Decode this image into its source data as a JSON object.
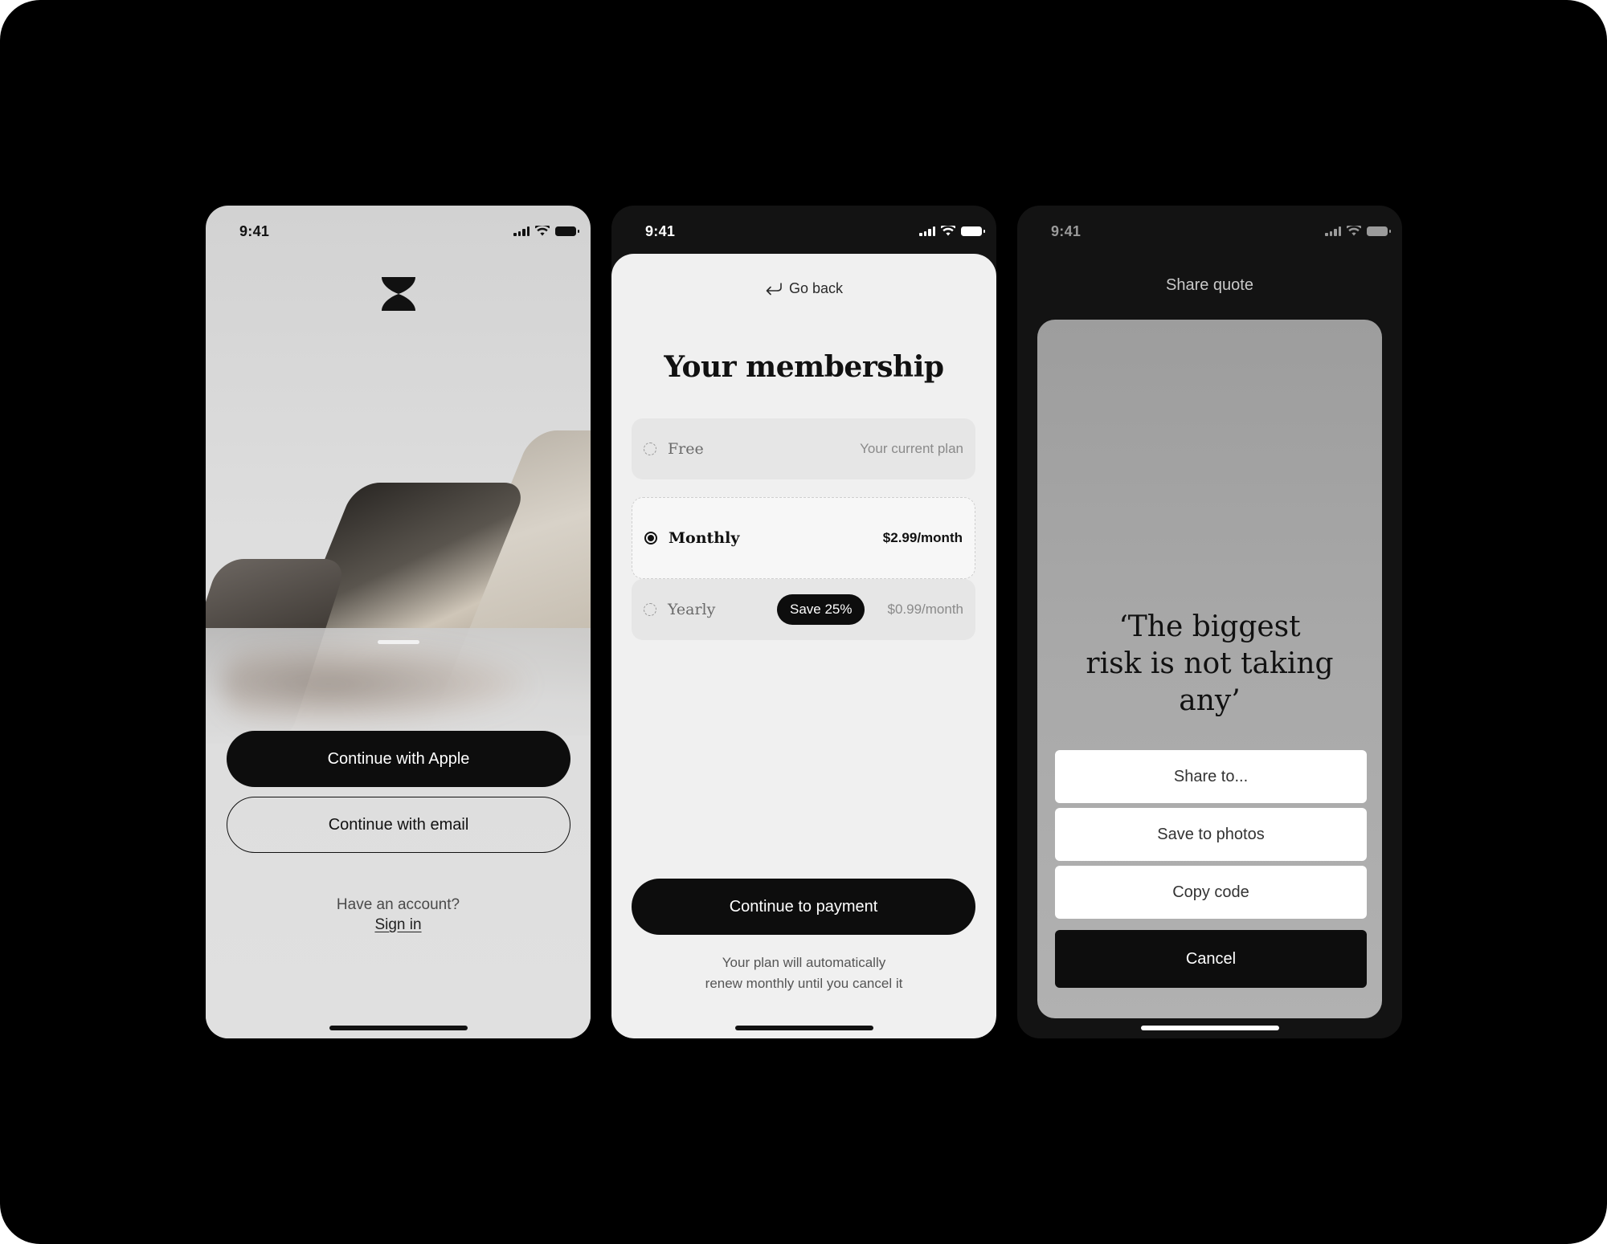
{
  "status": {
    "time": "9:41"
  },
  "screen1": {
    "logo_icon": "hourglass-logo",
    "apple_button": "Continue with Apple",
    "email_button": "Continue with email",
    "have_account": "Have an account?",
    "sign_in": "Sign in"
  },
  "screen2": {
    "go_back": "Go back",
    "title": "Your membership",
    "plans": [
      {
        "name": "Free",
        "detail": "Your current plan"
      },
      {
        "name": "Monthly",
        "detail": "$2.99/month"
      },
      {
        "name": "Yearly",
        "badge": "Save 25%",
        "detail": "$0.99/month"
      }
    ],
    "continue_button": "Continue to payment",
    "renew_note_line1": "Your plan will automatically",
    "renew_note_line2": "renew monthly until you cancel it"
  },
  "screen3": {
    "title": "Share quote",
    "quote_line1": "‘The biggest",
    "quote_line2": "risk is not taking",
    "quote_line3": "any’",
    "share_to": "Share to...",
    "save_photos": "Save to photos",
    "copy_code": "Copy code",
    "cancel": "Cancel"
  },
  "colors": {
    "canvas": "#000000",
    "dark_button": "#0d0d0d",
    "light_surface": "#f0f0f0",
    "dark_surface": "#131313"
  }
}
